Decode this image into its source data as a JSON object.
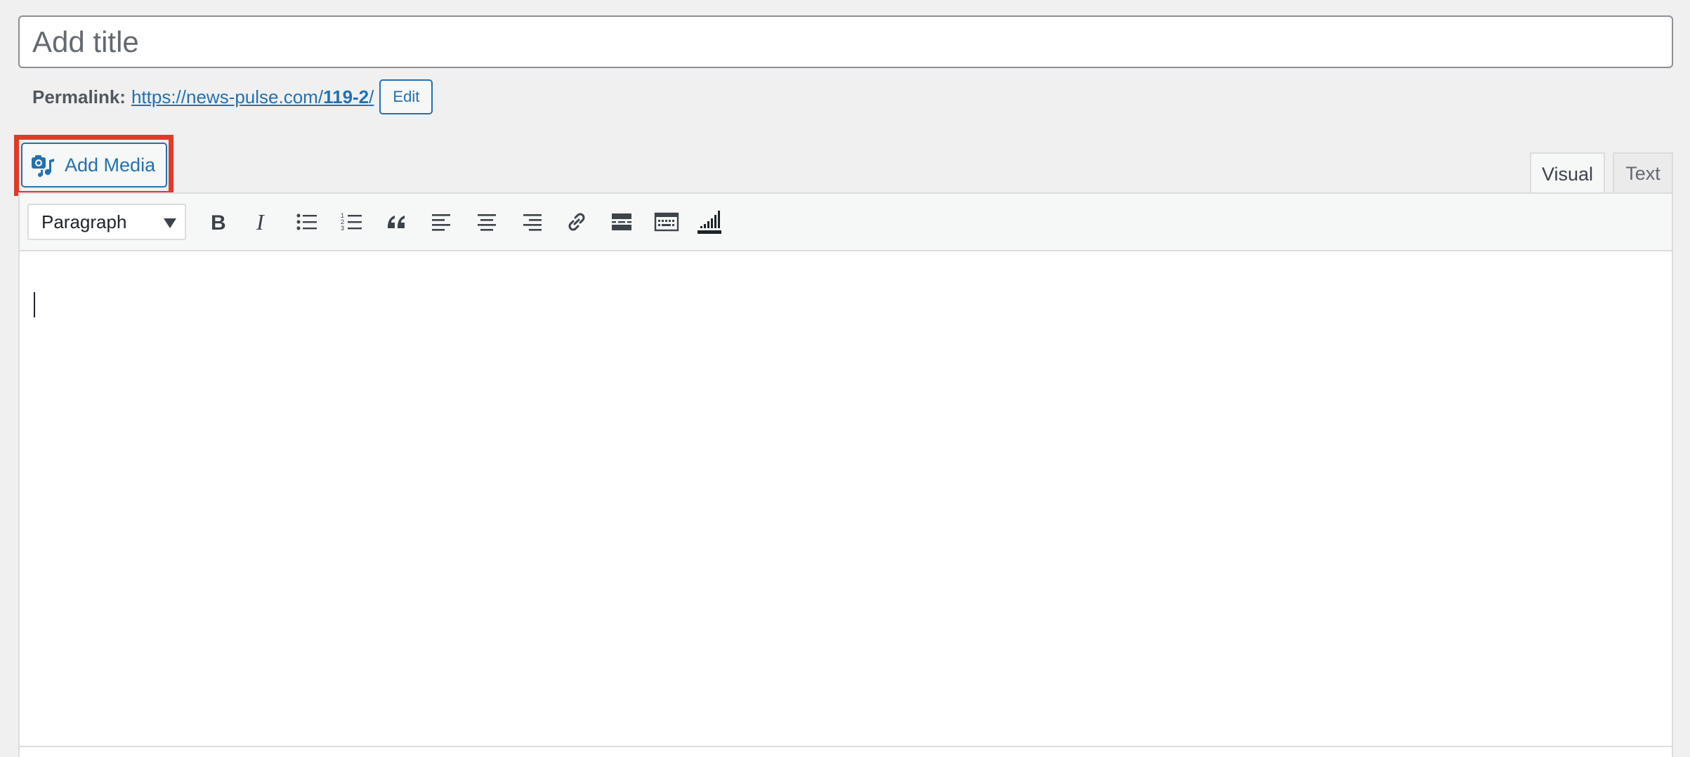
{
  "title_field": {
    "placeholder": "Add title",
    "value": ""
  },
  "permalink": {
    "label": "Permalink:",
    "url_base": "https://news-pulse.com/",
    "url_slug": "119-2",
    "url_trail": "/",
    "edit_label": "Edit"
  },
  "media": {
    "add_label": "Add Media",
    "highlight_color": "#e03a28"
  },
  "tabs": [
    {
      "label": "Visual",
      "active": true
    },
    {
      "label": "Text",
      "active": false
    }
  ],
  "toolbar": {
    "format_value": "Paragraph",
    "buttons": [
      "bold-icon",
      "italic-icon",
      "bulleted-list-icon",
      "numbered-list-icon",
      "blockquote-icon",
      "align-left-icon",
      "align-center-icon",
      "align-right-icon",
      "link-icon",
      "read-more-icon",
      "toolbar-toggle-icon",
      "wpquads-icon"
    ]
  },
  "colors": {
    "accent": "#2271b1",
    "text": "#1d2327",
    "background": "#f0f0f1"
  }
}
